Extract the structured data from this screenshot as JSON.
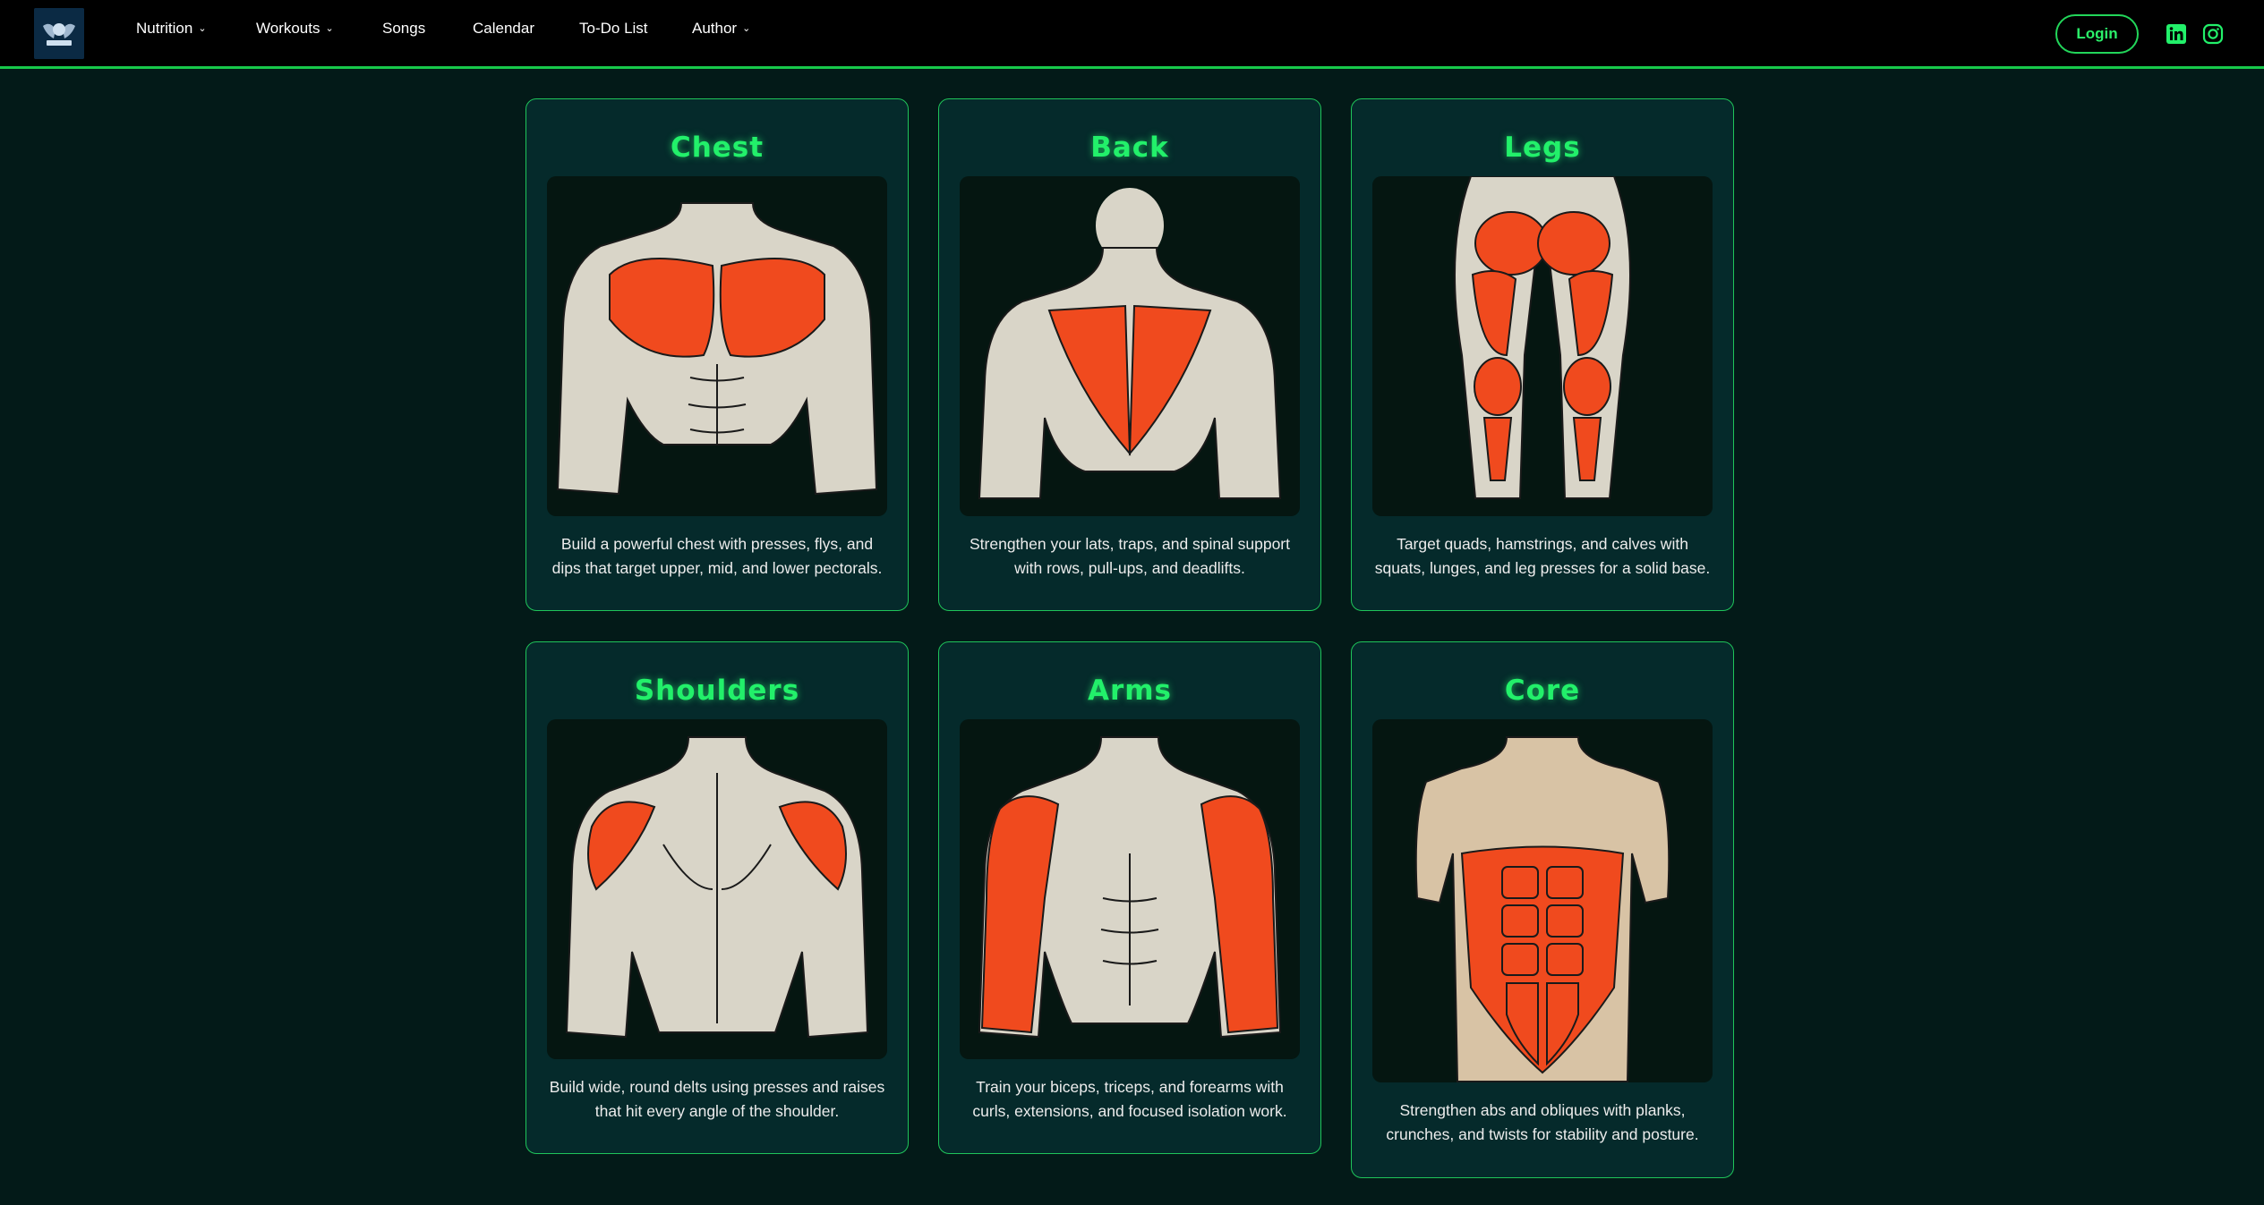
{
  "navbar": {
    "logo_alt": "FITNESS",
    "items": [
      {
        "label": "Nutrition",
        "dropdown": true
      },
      {
        "label": "Workouts",
        "dropdown": true
      },
      {
        "label": "Songs",
        "dropdown": false
      },
      {
        "label": "Calendar",
        "dropdown": false
      },
      {
        "label": "To-Do List",
        "dropdown": false
      },
      {
        "label": "Author",
        "dropdown": true
      }
    ],
    "login_label": "Login",
    "social": [
      "linkedin-icon",
      "instagram-icon"
    ]
  },
  "colors": {
    "accent": "#22f06a",
    "background": "#031a18",
    "card_bg": "#052a2b",
    "muscle": "#f04a1e",
    "skin": "#d9d5c8"
  },
  "cards": [
    {
      "title": "Chest",
      "description": "Build a powerful chest with presses, flys, and dips that target upper, mid, and lower pectorals.",
      "image": "chest-illustration"
    },
    {
      "title": "Back",
      "description": "Strengthen your lats, traps, and spinal support with rows, pull-ups, and deadlifts.",
      "image": "back-illustration"
    },
    {
      "title": "Legs",
      "description": "Target quads, hamstrings, and calves with squats, lunges, and leg presses for a solid base.",
      "image": "legs-illustration"
    },
    {
      "title": "Shoulders",
      "description": "Build wide, round delts using presses and raises that hit every angle of the shoulder.",
      "image": "shoulders-illustration"
    },
    {
      "title": "Arms",
      "description": "Train your biceps, triceps, and forearms with curls, extensions, and focused isolation work.",
      "image": "arms-illustration"
    },
    {
      "title": "Core",
      "description": "Strengthen abs and obliques with planks, crunches, and twists for stability and posture.",
      "image": "core-illustration"
    }
  ]
}
